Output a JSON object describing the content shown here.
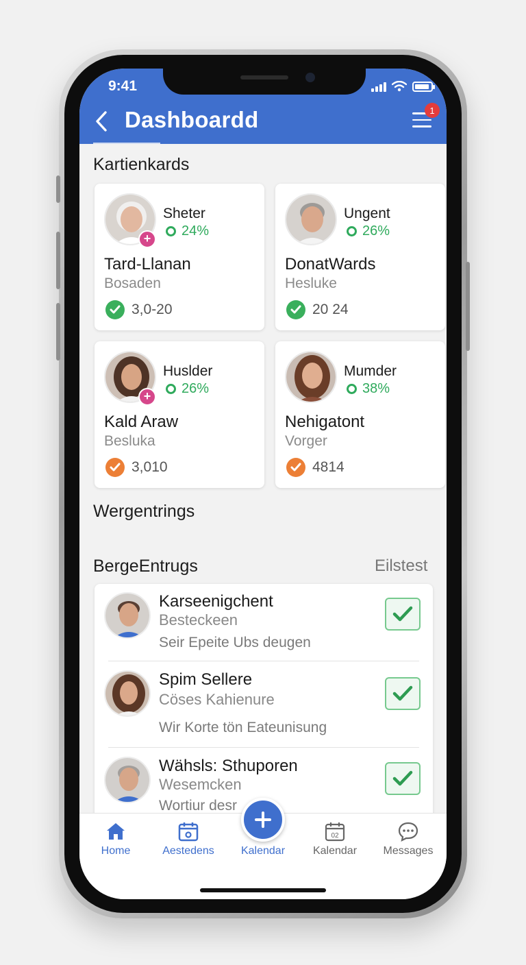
{
  "status_bar": {
    "time": "9:41"
  },
  "header": {
    "title": "Dashboardd",
    "notification_count": "1"
  },
  "sections": {
    "cards_title": "Kartienkards",
    "middle_title": "Wergentrings",
    "list_title": "BergeEntrugs",
    "list_action": "Eilstest"
  },
  "cards": [
    {
      "label": "Sheter",
      "percent": "24%",
      "name": "Tard-Llanan",
      "sub": "Bosaden",
      "value": "3,0-20",
      "status_color": "#3aaf5c",
      "has_plus_badge": true
    },
    {
      "label": "Ungent",
      "percent": "26%",
      "name": "DonatWards",
      "sub": "Hesluke",
      "value": "20 24",
      "status_color": "#3aaf5c",
      "has_plus_badge": false
    },
    {
      "label": "Huslder",
      "percent": "26%",
      "name": "Kald Araw",
      "sub": "Besluka",
      "value": "3,010",
      "status_color": "#ec7f36",
      "has_plus_badge": true
    },
    {
      "label": "Mumder",
      "percent": "38%",
      "name": "Nehigatont",
      "sub": "Vorger",
      "value": "4814",
      "status_color": "#ec7f36",
      "has_plus_badge": false
    }
  ],
  "list_items": [
    {
      "title": "Karseenigchent",
      "sub": "Besteckeen",
      "desc": "Seir Epeite Ubs deugen"
    },
    {
      "title": "Spim Sellere",
      "sub": "Cöses Kahienure",
      "desc": "Wir Korte tön Eateunisung"
    },
    {
      "title": "Wähsls: Sthuporen",
      "sub": "Wesemcken",
      "desc": "Wortiur desr"
    }
  ],
  "bottom_nav": [
    {
      "label": "Home",
      "icon": "home-icon",
      "active": true
    },
    {
      "label": "Aestedens",
      "icon": "calendar-icon",
      "active": true
    },
    {
      "label": "Kalendar",
      "icon": "plus-icon",
      "active": true
    },
    {
      "label": "Kalendar",
      "icon": "calendar-date-icon",
      "active": false
    },
    {
      "label": "Messages",
      "icon": "chat-bubble-icon",
      "active": false
    }
  ],
  "colors": {
    "brand": "#3f6fcd",
    "success": "#2faa5c",
    "warning": "#ec7f36",
    "badge": "#d6478b",
    "alert": "#e43c3c"
  }
}
